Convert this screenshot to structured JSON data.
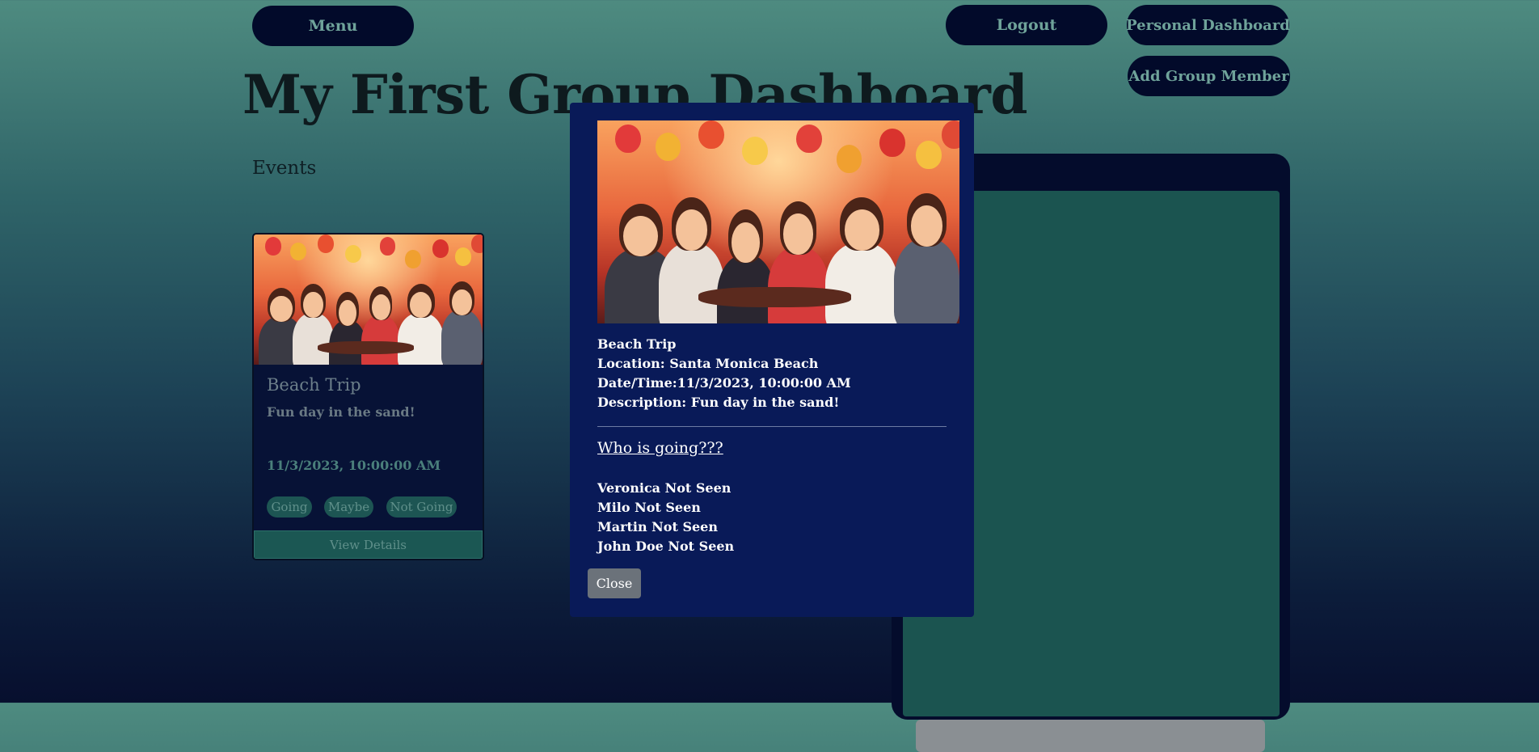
{
  "header": {
    "menu_label": "Menu",
    "logout_label": "Logout",
    "personal_dashboard_label": "Personal Dashboard",
    "add_group_member_label": "Add Group Member"
  },
  "page": {
    "title": "My First Group Dashboard",
    "events_heading": "Events"
  },
  "event_card": {
    "image": "party-illustration",
    "title": "Beach Trip",
    "description": "Fun day in the sand!",
    "datetime": "11/3/2023, 10:00:00 AM",
    "rsvp_options": [
      "Going",
      "Maybe",
      "Not Going"
    ],
    "view_details_label": "View Details"
  },
  "modal": {
    "image": "party-illustration",
    "title": "Beach Trip",
    "location": "Location: Santa Monica Beach",
    "datetime": "Date/Time:11/3/2023, 10:00:00 AM",
    "description": "Description: Fun day in the sand!",
    "who_heading": "Who is going???",
    "attendees": [
      "Veronica Not Seen",
      "Milo Not Seen",
      "Martin Not Seen",
      "John Doe Not Seen"
    ],
    "close_label": "Close"
  },
  "colors": {
    "button_bg": "#020a2a",
    "button_text": "#6fa39a",
    "modal_bg": "#091a58",
    "card_bg": "#071236",
    "panel_inner": "#1b5450",
    "close_button": "#6b727a"
  }
}
